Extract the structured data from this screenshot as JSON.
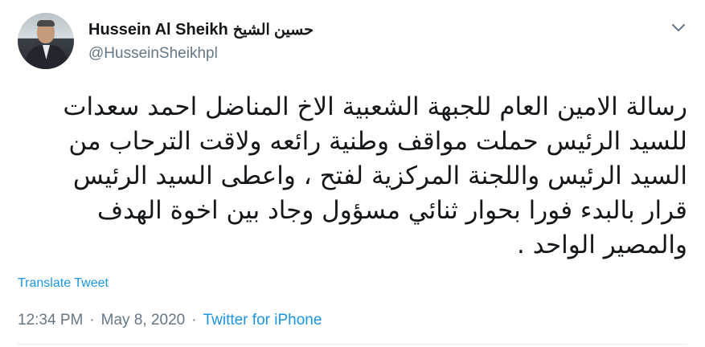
{
  "user": {
    "display_name": "Hussein Al Sheikh",
    "display_name_ar": "حسين الشيخ",
    "handle": "@HusseinSheikhpl",
    "avatar_icon": "profile-photo"
  },
  "tweet": {
    "lines": [
      "رسالة الامين العام للجبهة الشعبية الاخ المناضل احمد سعدات",
      "للسيد الرئيس حملت مواقف وطنية رائعه ولاقت الترحاب من",
      "السيد الرئيس واللجنة المركزية لفتح ، واعطى السيد الرئيس",
      "قرار بالبدء فورا بحوار ثنائي مسؤول وجاد بين اخوة الهدف",
      "والمصير الواحد ."
    ],
    "translate_label": "Translate Tweet"
  },
  "meta": {
    "time": "12:34 PM",
    "sep1": "·",
    "date": "May 8, 2020",
    "sep2": "·",
    "source": "Twitter for iPhone"
  },
  "colors": {
    "link": "#1b95e0",
    "muted": "#657786",
    "text": "#14171a"
  }
}
